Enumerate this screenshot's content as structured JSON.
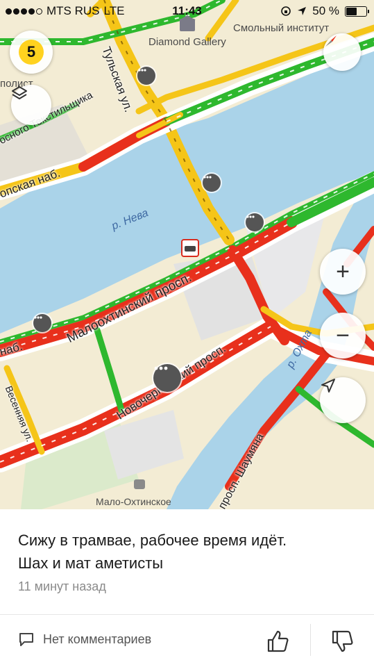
{
  "status_bar": {
    "carrier": "MTS RUS",
    "network": "LTE",
    "time": "11:43",
    "battery": "50 %",
    "icons": [
      "signal-dots-icon",
      "rotation-lock-icon",
      "location-arrow-icon",
      "battery-icon"
    ]
  },
  "map": {
    "labels": {
      "smolny": "Смольный институт",
      "diamond": "Diamond Gallery",
      "tulskaya": "Тульская ул.",
      "tekstilshchika": "осного Текстильщика",
      "polist": "полист",
      "embankment": "опская наб.",
      "neva": "р. Нева",
      "malookhtinsky": "Малоохтинский просп.",
      "nab": "наб.",
      "novocherkassky": "Новочеркасский просп.",
      "vesennyaya": "Весенняя ул.",
      "okhta": "р. Охта",
      "shaumyana": "просп. Шаумяна",
      "malo_okhtinskoe": "Мало-Охтинское"
    },
    "traffic_score": "5",
    "colors": {
      "map_bg": "#f3ecd4",
      "water": "#aad3e9",
      "jam_red": "#e8301c",
      "slow_yellow": "#f5c518",
      "free_green": "#2eb82e",
      "score_yellow": "#ffd21f"
    }
  },
  "controls": {
    "layers": "layers-icon",
    "compass": "compass-icon",
    "zoom_in": "+",
    "zoom_out": "−",
    "locate": "locate-arrow-icon"
  },
  "post": {
    "text_line1": "Сижу в трамвае, рабочее время идёт.",
    "text_line2": "Шах и мат аметисты",
    "time": "11 минут назад",
    "comments": "Нет комментариев"
  }
}
